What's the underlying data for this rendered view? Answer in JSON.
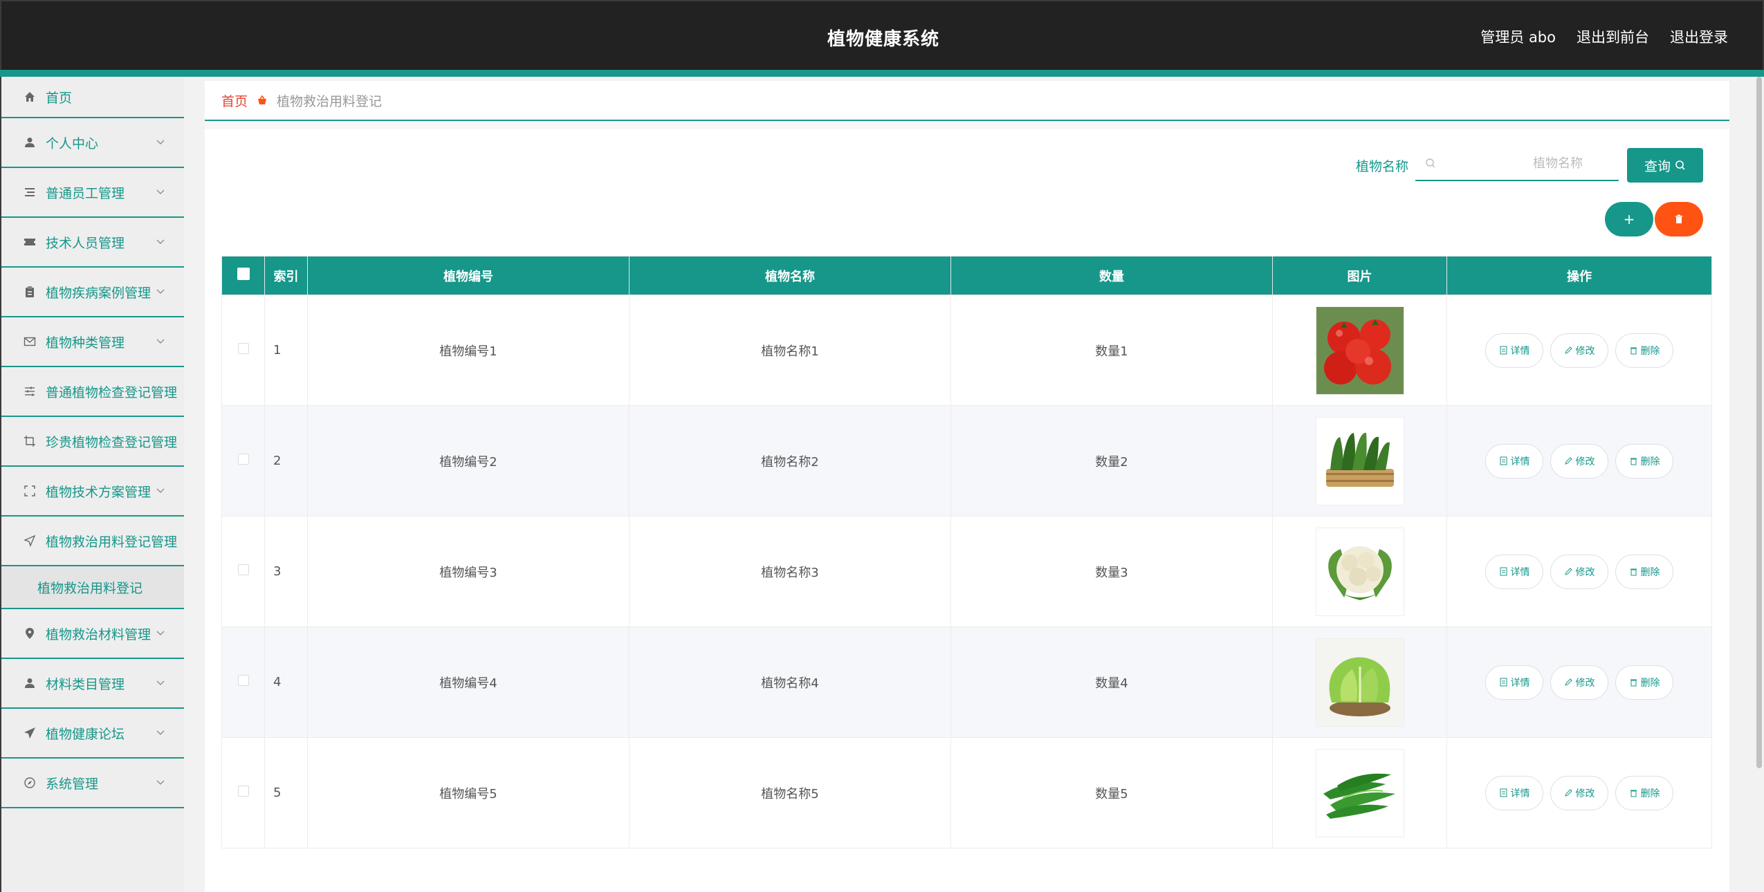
{
  "header": {
    "title": "植物健康系统",
    "admin_label": "管理员 abo",
    "to_front": "退出到前台",
    "logout": "退出登录"
  },
  "sidebar": {
    "items": [
      {
        "label": "首页",
        "icon": "home-icon",
        "expandable": false
      },
      {
        "label": "个人中心",
        "icon": "user-icon",
        "expandable": true
      },
      {
        "label": "普通员工管理",
        "icon": "list-icon",
        "expandable": true
      },
      {
        "label": "技术人员管理",
        "icon": "ticket-icon",
        "expandable": true
      },
      {
        "label": "植物疾病案例管理",
        "icon": "clipboard-icon",
        "expandable": true
      },
      {
        "label": "植物种类管理",
        "icon": "mail-icon",
        "expandable": true
      },
      {
        "label": "普通植物检查登记管理",
        "icon": "sliders-icon",
        "expandable": false
      },
      {
        "label": "珍贵植物检查登记管理",
        "icon": "crop-icon",
        "expandable": false
      },
      {
        "label": "植物技术方案管理",
        "icon": "fullscreen-icon",
        "expandable": true
      },
      {
        "label": "植物救治用料登记管理",
        "icon": "send-icon",
        "expandable": false
      },
      {
        "label": "植物救治材料管理",
        "icon": "pin-icon",
        "expandable": true
      },
      {
        "label": "材料类目管理",
        "icon": "user-icon",
        "expandable": true
      },
      {
        "label": "植物健康论坛",
        "icon": "paper-plane-icon",
        "expandable": true
      },
      {
        "label": "系统管理",
        "icon": "compass-icon",
        "expandable": true
      }
    ],
    "sub_item": "植物救治用料登记"
  },
  "breadcrumb": {
    "home": "首页",
    "current": "植物救治用料登记"
  },
  "search": {
    "label": "植物名称",
    "placeholder": "植物名称",
    "button": "查询"
  },
  "actions": {
    "add": "+"
  },
  "table": {
    "headers": [
      "索引",
      "植物编号",
      "植物名称",
      "数量",
      "图片",
      "操作"
    ],
    "rows": [
      {
        "index": "1",
        "code": "植物编号1",
        "name": "植物名称1",
        "qty": "数量1",
        "img": "tomato"
      },
      {
        "index": "2",
        "code": "植物编号2",
        "name": "植物名称2",
        "qty": "数量2",
        "img": "greens"
      },
      {
        "index": "3",
        "code": "植物编号3",
        "name": "植物名称3",
        "qty": "数量3",
        "img": "cauliflower"
      },
      {
        "index": "4",
        "code": "植物编号4",
        "name": "植物名称4",
        "qty": "数量4",
        "img": "lettuce"
      },
      {
        "index": "5",
        "code": "植物编号5",
        "name": "植物名称5",
        "qty": "数量5",
        "img": "peas"
      }
    ],
    "ops": {
      "detail": "详情",
      "edit": "修改",
      "delete": "删除"
    }
  },
  "colors": {
    "accent": "#16978a",
    "danger": "#ff5314",
    "header_bg": "#222222"
  }
}
